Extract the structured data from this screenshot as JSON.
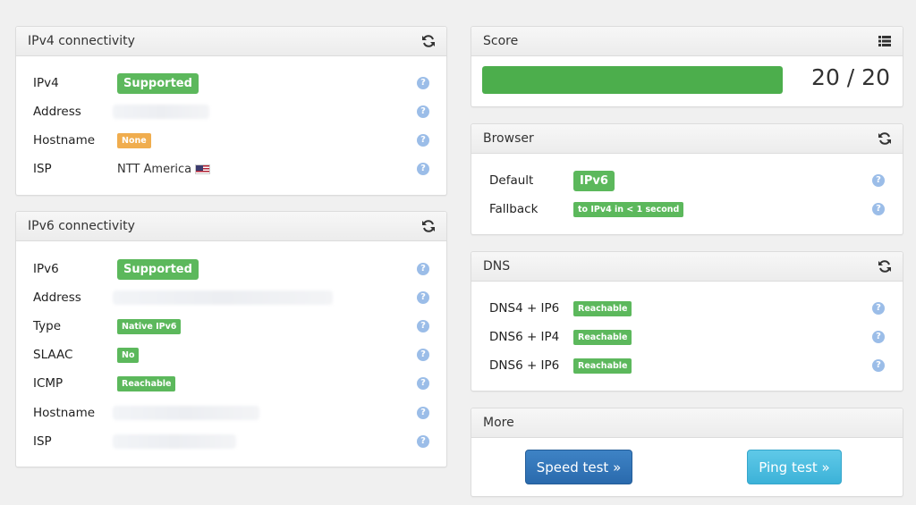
{
  "ipv4": {
    "title": "IPv4 connectivity",
    "refresh_icon": "refresh-icon",
    "rows": [
      {
        "label": "IPv4",
        "value": "Supported"
      },
      {
        "label": "Address",
        "value": ""
      },
      {
        "label": "Hostname",
        "value": "None"
      },
      {
        "label": "ISP",
        "value": "NTT America"
      }
    ]
  },
  "ipv6": {
    "title": "IPv6 connectivity",
    "refresh_icon": "refresh-icon",
    "rows": [
      {
        "label": "IPv6",
        "value": "Supported"
      },
      {
        "label": "Address",
        "value": ""
      },
      {
        "label": "Type",
        "value": "Native IPv6"
      },
      {
        "label": "SLAAC",
        "value": "No"
      },
      {
        "label": "ICMP",
        "value": "Reachable"
      },
      {
        "label": "Hostname",
        "value": ""
      },
      {
        "label": "ISP",
        "value": ""
      }
    ]
  },
  "score": {
    "title": "Score",
    "list_icon": "list-icon",
    "text": "20 / 20",
    "progress_fraction": 1.0
  },
  "browser": {
    "title": "Browser",
    "refresh_icon": "refresh-icon",
    "rows": [
      {
        "label": "Default",
        "value": "IPv6"
      },
      {
        "label": "Fallback",
        "value": "to IPv4 in < 1 second"
      }
    ]
  },
  "dns": {
    "title": "DNS",
    "refresh_icon": "refresh-icon",
    "rows": [
      {
        "label": "DNS4 + IP6",
        "value": "Reachable"
      },
      {
        "label": "DNS6 + IP4",
        "value": "Reachable"
      },
      {
        "label": "DNS6 + IP6",
        "value": "Reachable"
      }
    ]
  },
  "more": {
    "title": "More",
    "speed_test": "Speed test »",
    "ping_test": "Ping test »"
  },
  "colors": {
    "success": "#5cb85c",
    "warning": "#f0ad4e",
    "primary": "#2a6aad",
    "info": "#3cb2d8",
    "help": "#9bbde8"
  }
}
